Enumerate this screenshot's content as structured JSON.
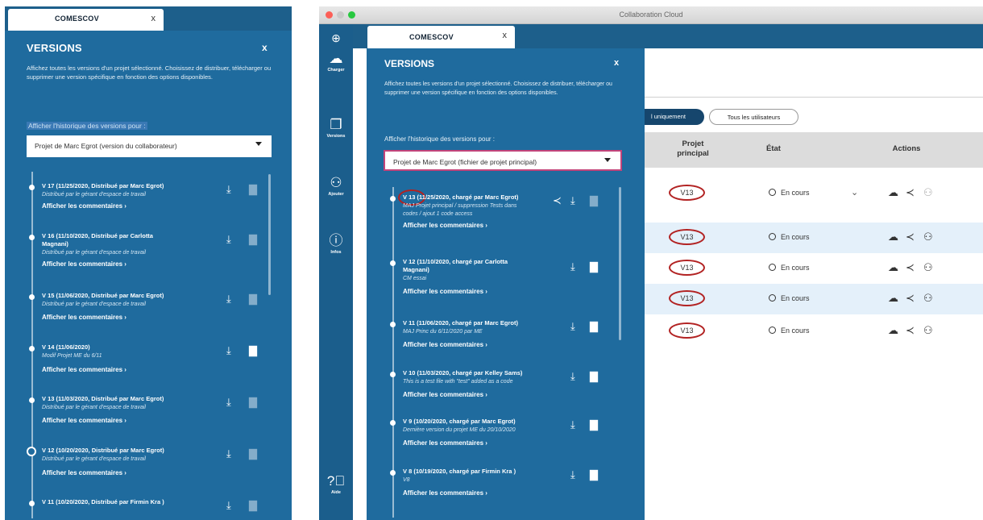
{
  "left": {
    "tab": {
      "label": "COMESCOV",
      "close": "x"
    },
    "panel": {
      "title": "VERSIONS",
      "close": "x",
      "description": "Affichez toutes les versions d'un projet sélectionné. Choisissez de distribuer, télécharger ou supprimer une version spécifique en fonction des options disponibles.",
      "history_label": "Afficher l'historique des versions pour :",
      "select_value": "Projet de Marc Egrot (version du collaborateur)"
    },
    "versions": [
      {
        "title": "V 17 (11/25/2020, Distribué par Marc Egrot)",
        "desc": "Distribué par le gérant d'espace de travail",
        "comments": "Afficher les commentaires ›"
      },
      {
        "title": "V 16 (11/10/2020, Distribué par Carlotta",
        "title2": "Magnani)",
        "desc": "Distribué par le gérant d'espace de travail",
        "comments": "Afficher les commentaires ›"
      },
      {
        "title": "V 15 (11/06/2020, Distribué par Marc Egrot)",
        "desc": "Distribué par le gérant d'espace de travail",
        "comments": "Afficher les commentaires ›"
      },
      {
        "title": "V 14 (11/06/2020)",
        "desc": "Modif Projet ME du 6/11",
        "comments": "Afficher les commentaires ›"
      },
      {
        "title": "V 13 (11/03/2020, Distribué par Marc Egrot)",
        "desc": "Distribué par le gérant d'espace de travail",
        "comments": "Afficher les commentaires ›"
      },
      {
        "title": "V 12 (10/20/2020, Distribué par Marc Egrot)",
        "desc": "Distribué par le gérant d'espace de travail",
        "comments": "Afficher les commentaires ›"
      },
      {
        "title": "V 11 (10/20/2020, Distribué par Firmin Kra )"
      }
    ]
  },
  "right": {
    "window_title": "Collaboration Cloud",
    "tab": {
      "label": "COMESCOV",
      "close": "x"
    },
    "rail": [
      {
        "icon": "plus-circle-icon",
        "label": ""
      },
      {
        "icon": "cloud-upload-icon",
        "label": "Charger"
      },
      {
        "icon": "versions-icon",
        "label": "Versions"
      },
      {
        "icon": "add-user-icon",
        "label": "Ajouter"
      },
      {
        "icon": "info-icon",
        "label": "Infos"
      },
      {
        "icon": "help-icon",
        "label": "Aide"
      }
    ],
    "panel": {
      "title": "VERSIONS",
      "close": "x",
      "description": "Affichez toutes les versions d'un projet sélectionné. Choisissez de distribuer, télécharger ou supprimer une version spécifique en fonction des options disponibles.",
      "history_label": "Afficher l'historique des versions pour :",
      "select_value": "Projet de Marc Egrot (fichier de projet principal)"
    },
    "versions": [
      {
        "title": "V 13 (11/25/2020, chargé par Marc Egrot)",
        "desc": "MAJ Projet principal / suppression Tests dans",
        "desc2": "codes / ajout 1 code access",
        "comments": "Afficher les commentaires ›"
      },
      {
        "title": "V 12 (11/10/2020, chargé par Carlotta",
        "title2": "Magnani)",
        "desc": "CM essai",
        "comments": "Afficher les commentaires ›"
      },
      {
        "title": "V 11 (11/06/2020, chargé par Marc Egrot)",
        "desc": "MAJ Princ du 6/11/2020 par ME",
        "comments": "Afficher les commentaires ›"
      },
      {
        "title": "V 10 (11/03/2020, chargé par Kelley Sams)",
        "desc": "This is a test file with \"test\" added as a code",
        "comments": "Afficher les commentaires ›"
      },
      {
        "title": "V 9 (10/20/2020, chargé par Marc Egrot)",
        "desc": "Dernière version du projet ME du 20/10/2020",
        "comments": "Afficher les commentaires ›"
      },
      {
        "title": "V 8 (10/19/2020, chargé par Firmin Kra )",
        "desc": "V8",
        "comments": "Afficher les commentaires ›"
      }
    ],
    "filters": {
      "active": "l uniquement",
      "other": "Tous les utilisateurs"
    },
    "table": {
      "headers": {
        "project": "Projet principal",
        "state": "État",
        "actions": "Actions"
      },
      "rows": [
        {
          "version": "V13",
          "state": "En cours"
        },
        {
          "version": "V13",
          "state": "En cours"
        },
        {
          "version": "V13",
          "state": "En cours"
        },
        {
          "version": "V13",
          "state": "En cours"
        },
        {
          "version": "V13",
          "state": "En cours"
        }
      ]
    }
  },
  "colors": {
    "panel_blue": "#1f6b9e",
    "rail_blue": "#1b5e8c",
    "highlight_red": "#b22222",
    "select_border": "#c2447a"
  }
}
